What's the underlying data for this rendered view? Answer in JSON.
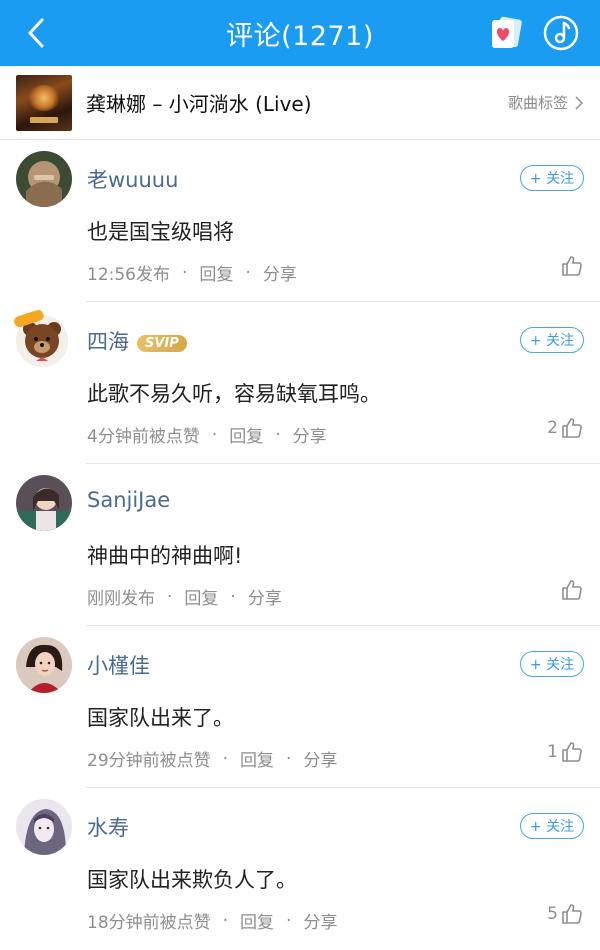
{
  "header": {
    "title": "评论(1271)"
  },
  "song": {
    "title": "龚琳娜 – 小河淌水 (Live)",
    "tag_label": "歌曲标签"
  },
  "follow_label": "+ 关注",
  "comments": [
    {
      "username": "老wuuuu",
      "badge": "",
      "text": "也是国宝级唱将",
      "time": "12:56发布",
      "reply": "回复",
      "share": "分享",
      "likes": ""
    },
    {
      "username": "四海",
      "badge": "SVIP",
      "text": "此歌不易久听，容易缺氧耳鸣。",
      "time": "4分钟前被点赞",
      "reply": "回复",
      "share": "分享",
      "likes": "2"
    },
    {
      "username": "SanjiJae",
      "badge": "",
      "text": "神曲中的神曲啊!",
      "time": "刚刚发布",
      "reply": "回复",
      "share": "分享",
      "likes": ""
    },
    {
      "username": "小槿佳",
      "badge": "",
      "text": "国家队出来了。",
      "time": "29分钟前被点赞",
      "reply": "回复",
      "share": "分享",
      "likes": "1"
    },
    {
      "username": "水寿",
      "badge": "",
      "text": "国家队出来欺负人了。",
      "time": "18分钟前被点赞",
      "reply": "回复",
      "share": "分享",
      "likes": "5"
    }
  ],
  "colors": {
    "header_bg": "#1a9cf3",
    "username": "#4a6a8f",
    "follow": "#3d9be6",
    "meta": "#8e8e8e",
    "svip": "#d6a646"
  }
}
